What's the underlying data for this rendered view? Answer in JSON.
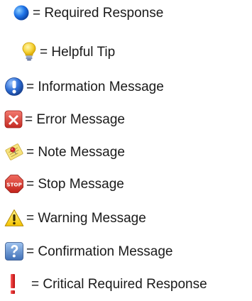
{
  "legend": {
    "items": [
      {
        "icon": "blue-dot-icon",
        "text": "= Required Response"
      },
      {
        "icon": "lightbulb-icon",
        "text": "= Helpful Tip"
      },
      {
        "icon": "info-icon",
        "text": "= Information Message"
      },
      {
        "icon": "error-x-icon",
        "text": "= Error Message"
      },
      {
        "icon": "note-icon",
        "text": "= Note Message"
      },
      {
        "icon": "stop-sign-icon",
        "text": "= Stop Message",
        "icon_text": "STOP"
      },
      {
        "icon": "warning-triangle-icon",
        "text": "= Warning Message"
      },
      {
        "icon": "question-icon",
        "text": "= Confirmation Message"
      },
      {
        "icon": "red-exclamation-icon",
        "text": "= Critical Required Response"
      }
    ]
  },
  "colors": {
    "text": "#1a1a1a",
    "required_blue": "#1e73e8",
    "bulb_yellow": "#f6d33a",
    "info_blue": "#2f6fd6",
    "error_red": "#e0443d",
    "note_yellow": "#f7e27c",
    "stop_red": "#d8352c",
    "warning_yellow": "#f5c400",
    "question_blue": "#4f86c9",
    "critical_red": "#e11919"
  }
}
